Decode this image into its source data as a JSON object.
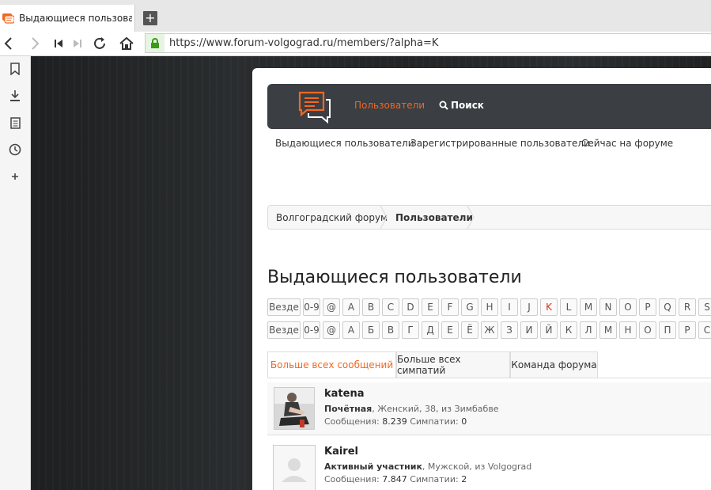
{
  "browser": {
    "tab_title": "Выдающиеся пользователи",
    "new_tab": "+",
    "url": "https://www.forum-volgograd.ru/members/?alpha=K"
  },
  "header": {
    "nav_members": "Пользователи",
    "nav_search": "Поиск"
  },
  "subnav": [
    "Выдающиеся пользователи",
    "Зарегистрированные пользователи",
    "Сейчас на форуме"
  ],
  "breadcrumb": [
    "Волгоградский форум",
    "Пользователи"
  ],
  "page_title": "Выдающиеся пользователи",
  "latin_row": {
    "all": "Везде",
    "num": "0-9",
    "at": "@",
    "letters": [
      "A",
      "B",
      "C",
      "D",
      "E",
      "F",
      "G",
      "H",
      "I",
      "J",
      "K",
      "L",
      "M",
      "N",
      "O",
      "P",
      "Q",
      "R",
      "S"
    ]
  },
  "cyr_row": {
    "all": "Везде",
    "num": "0-9",
    "at": "@",
    "letters": [
      "А",
      "Б",
      "В",
      "Г",
      "Д",
      "Е",
      "Ё",
      "Ж",
      "З",
      "И",
      "Й",
      "К",
      "Л",
      "М",
      "Н",
      "О",
      "П",
      "Р",
      "С"
    ]
  },
  "tabs": [
    "Больше всех сообщений",
    "Больше всех симпатий",
    "Команда форума"
  ],
  "members": [
    {
      "name": "katena",
      "title": "Почётная",
      "info": ", Женский, 38, из Зимбабве",
      "msgs_label": "Сообщения:",
      "msgs": "8.239",
      "likes_label": "Симпатии:",
      "likes": "0"
    },
    {
      "name": "Kairel",
      "title": "Активный участник",
      "info": ", Мужской, из Volgograd",
      "msgs_label": "Сообщения:",
      "msgs": "7.847",
      "likes_label": "Симпатии:",
      "likes": "2"
    }
  ],
  "colors": {
    "accent": "#f26722",
    "active_letter": "#e0301e",
    "header_bg": "#3b3e42"
  }
}
